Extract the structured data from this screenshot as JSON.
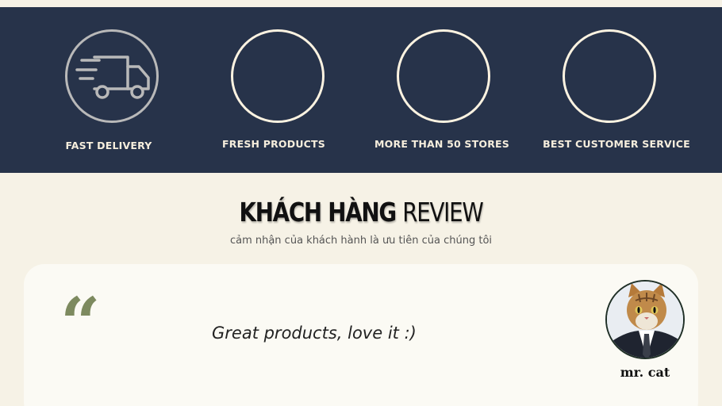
{
  "features": [
    {
      "label": "FAST DELIVERY",
      "icon": "delivery-truck-icon"
    },
    {
      "label": "FRESH PRODUCTS",
      "icon": "empty-circle-icon"
    },
    {
      "label": "MORE THAN 50 STORES",
      "icon": "empty-circle-icon"
    },
    {
      "label": "BEST CUSTOMER SERVICE",
      "icon": "empty-circle-icon"
    }
  ],
  "review_section": {
    "title_bold": "KHÁCH HÀNG",
    "title_light": "REVIEW",
    "subtitle": "cảm nhận của khách hành là ưu tiên của chúng tôi"
  },
  "review": {
    "quote_mark": "“",
    "text": "Great products, love it :)",
    "reviewer": "mr. cat",
    "avatar": "cat-in-suit-avatar"
  },
  "colors": {
    "band": "#27334a",
    "cream": "#f6f2e6",
    "card": "#fbfaf4",
    "quote": "#7d8a5f",
    "ring_light": "#fdf3e1",
    "ring_gray": "#b9b9b9"
  }
}
